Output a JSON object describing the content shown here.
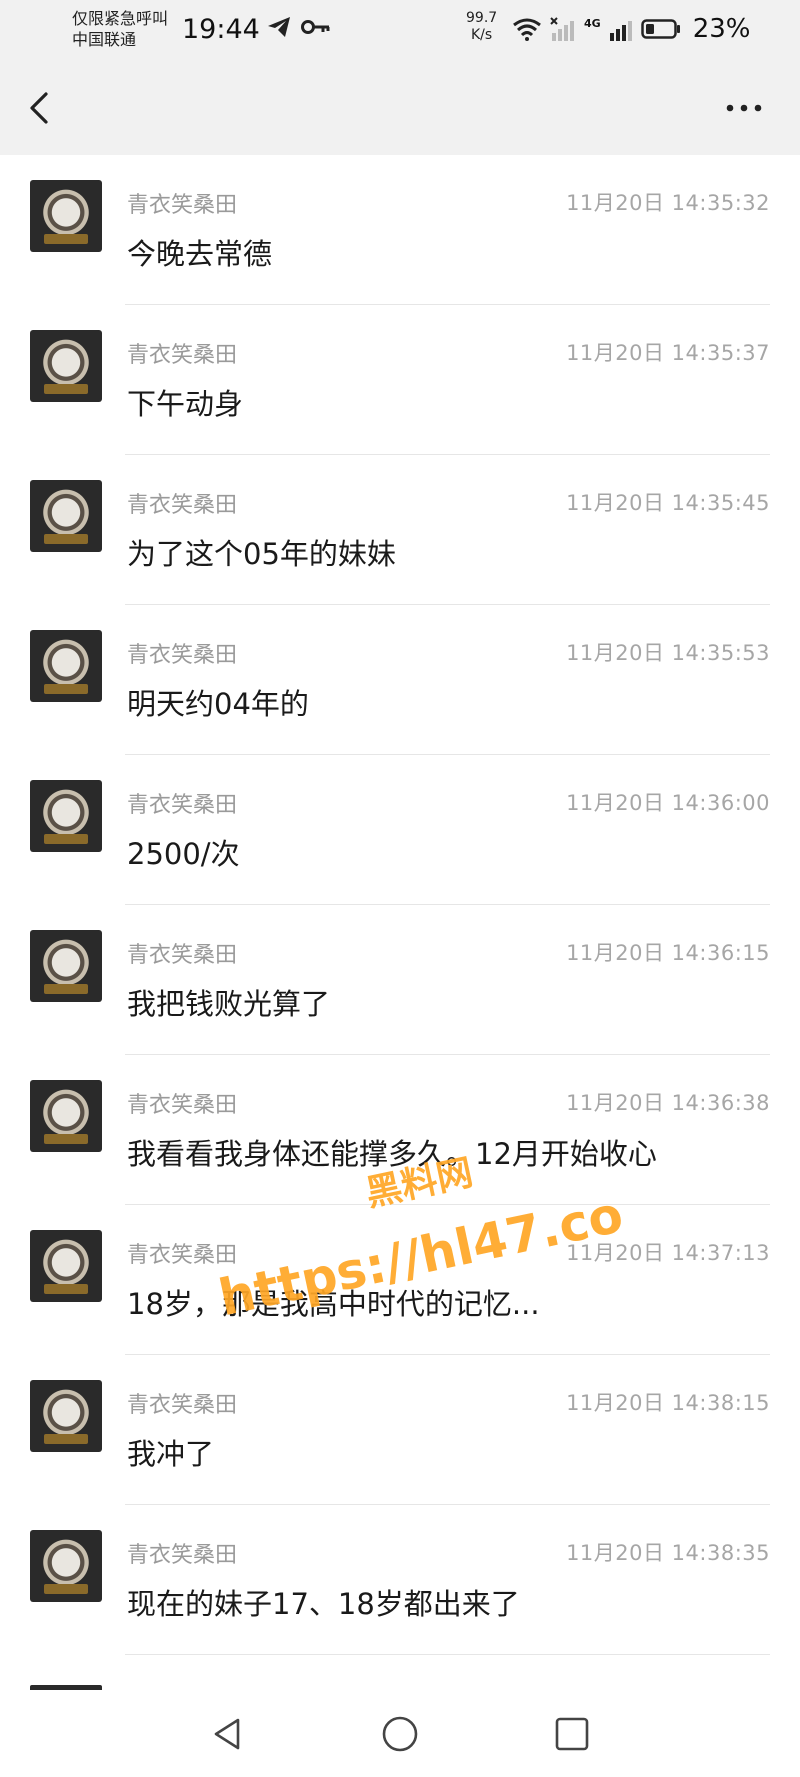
{
  "status_bar": {
    "carrier_line1": "仅限紧急呼叫",
    "carrier_line2": "中国联通",
    "time": "19:44",
    "net_speed_value": "99.7",
    "net_speed_unit": "K/s",
    "network_type": "4G",
    "battery_percent": "23%",
    "icons": [
      "telegram-icon",
      "key-icon",
      "wifi-icon",
      "signal-icon",
      "battery-icon"
    ]
  },
  "header": {
    "back_icon": "chevron-left-icon",
    "more_icon": "more-dots-icon"
  },
  "messages": [
    {
      "sender": "青衣笑桑田",
      "time": "11月20日 14:35:32",
      "text": "今晚去常德"
    },
    {
      "sender": "青衣笑桑田",
      "time": "11月20日 14:35:37",
      "text": "下午动身"
    },
    {
      "sender": "青衣笑桑田",
      "time": "11月20日 14:35:45",
      "text": "为了这个05年的妹妹"
    },
    {
      "sender": "青衣笑桑田",
      "time": "11月20日 14:35:53",
      "text": "明天约04年的"
    },
    {
      "sender": "青衣笑桑田",
      "time": "11月20日 14:36:00",
      "text": "2500/次"
    },
    {
      "sender": "青衣笑桑田",
      "time": "11月20日 14:36:15",
      "text": "我把钱败光算了"
    },
    {
      "sender": "青衣笑桑田",
      "time": "11月20日 14:36:38",
      "text": "我看看我身体还能撑多久。12月开始收心"
    },
    {
      "sender": "青衣笑桑田",
      "time": "11月20日 14:37:13",
      "text": "18岁，那是我高中时代的记忆..."
    },
    {
      "sender": "青衣笑桑田",
      "time": "11月20日 14:38:15",
      "text": "我冲了"
    },
    {
      "sender": "青衣笑桑田",
      "time": "11月20日 14:38:35",
      "text": "现在的妹子17、18岁都出来了"
    }
  ],
  "watermark": {
    "cn": "黑料网",
    "url": "https://hl47.co"
  },
  "nav": {
    "back": "triangle-back-icon",
    "home": "circle-home-icon",
    "recents": "square-recents-icon"
  }
}
